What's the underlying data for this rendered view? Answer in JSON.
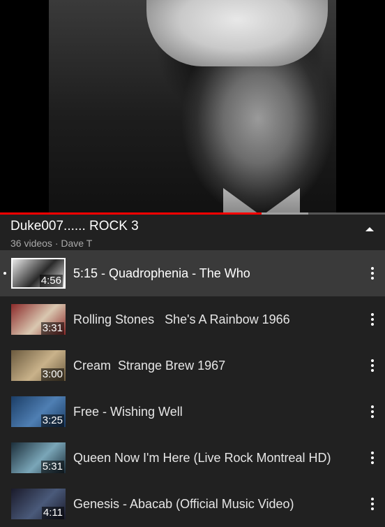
{
  "video": {
    "progress_played": 0.68,
    "progress_buffered": 0.8
  },
  "playlist": {
    "title": "Duke007...... ROCK 3",
    "subtitle": "36 videos · Dave T",
    "items": [
      {
        "title": "5:15 - Quadrophenia - The Who",
        "duration": "4:56",
        "active": true,
        "thumb_colors": [
          "#e8e8e8",
          "#2a2a2a"
        ]
      },
      {
        "title": "Rolling Stones   She's A Rainbow 1966",
        "duration": "3:31",
        "active": false,
        "thumb_colors": [
          "#8b2a2a",
          "#d9c7b0"
        ]
      },
      {
        "title": "Cream  Strange Brew 1967",
        "duration": "3:00",
        "active": false,
        "thumb_colors": [
          "#6b5a3e",
          "#c9b28a"
        ]
      },
      {
        "title": "Free - Wishing Well",
        "duration": "3:25",
        "active": false,
        "thumb_colors": [
          "#1b3d66",
          "#4f7fb3"
        ]
      },
      {
        "title": "Queen Now I'm Here (Live Rock Montreal HD)",
        "duration": "5:31",
        "active": false,
        "thumb_colors": [
          "#1c2e3a",
          "#7aa6b8"
        ]
      },
      {
        "title": "Genesis - Abacab (Official Music Video)",
        "duration": "4:11",
        "active": false,
        "thumb_colors": [
          "#1a1a2a",
          "#4a5a7a"
        ]
      }
    ]
  }
}
